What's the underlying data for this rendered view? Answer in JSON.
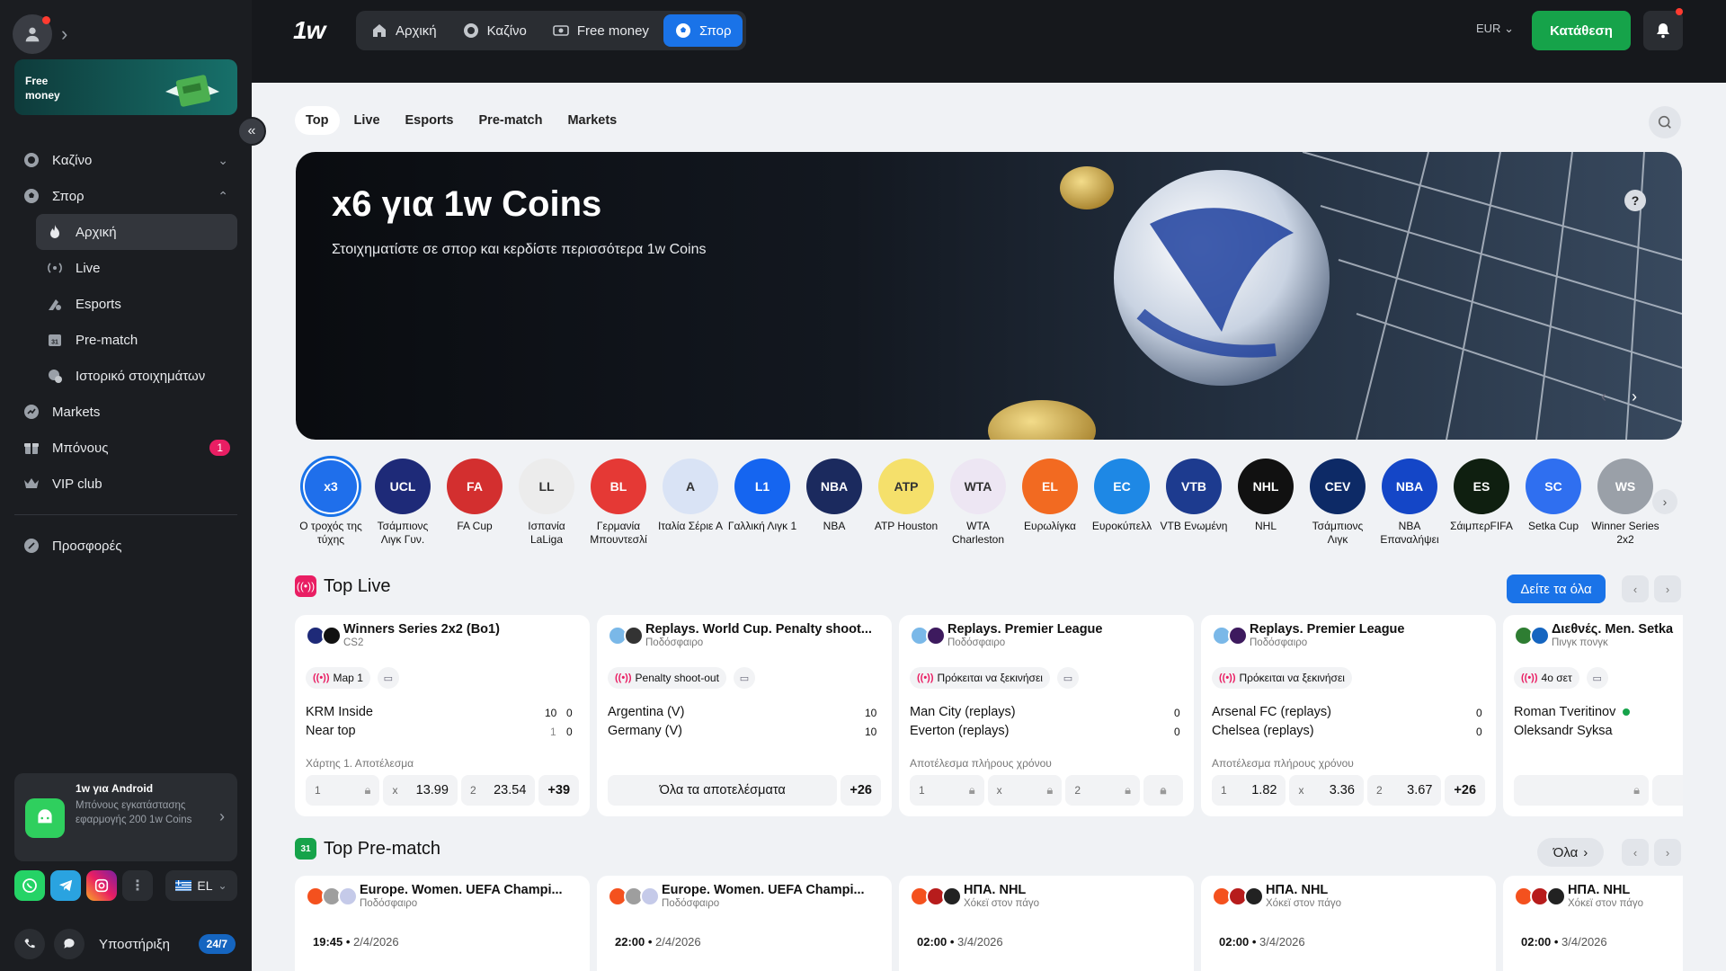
{
  "sidebar": {
    "promo_text": "Free money",
    "collapse_glyph": "«",
    "items": [
      {
        "label": "Καζίνο",
        "icon": "casino-chip-icon",
        "chev": "⌄"
      },
      {
        "label": "Σπορ",
        "icon": "soccer-ball-icon",
        "chev": "⌃"
      }
    ],
    "sub_items": [
      {
        "label": "Αρχική",
        "icon": "fire-icon",
        "active": true
      },
      {
        "label": "Live",
        "icon": "live-broadcast-icon"
      },
      {
        "label": "Esports",
        "icon": "esports-icon"
      },
      {
        "label": "Pre-match",
        "icon": "calendar-icon",
        "glyph": "31"
      },
      {
        "label": "Ιστορικό στοιχημάτων",
        "icon": "bet-history-icon"
      }
    ],
    "items2": [
      {
        "label": "Markets",
        "icon": "markets-icon"
      },
      {
        "label": "Μπόνους",
        "icon": "gift-icon",
        "badge": "1"
      },
      {
        "label": "VIP club",
        "icon": "crown-icon"
      }
    ],
    "offers": "Προσφορές",
    "app": {
      "title": "1w για Android",
      "desc": "Μπόνους εγκατάστασης εφαρμογής 200 1w Coins"
    },
    "lang": "EL",
    "support": "Υποστήριξη",
    "support_badge": "24/7"
  },
  "header": {
    "logo": "1w",
    "nav": [
      {
        "label": "Αρχική",
        "icon": "home-icon"
      },
      {
        "label": "Καζίνο",
        "icon": "casino-chip-icon"
      },
      {
        "label": "Free money",
        "icon": "money-icon"
      },
      {
        "label": "Σπορ",
        "icon": "soccer-ball-icon",
        "active": true
      }
    ],
    "currency": "EUR",
    "deposit": "Κατάθεση"
  },
  "subtabs": [
    "Top",
    "Live",
    "Esports",
    "Pre-match",
    "Markets"
  ],
  "banner": {
    "title": "x6 για 1w Coins",
    "subtitle": "Στοιχηματίστε σε σπορ και κερδίστε περισσότερα 1w Coins",
    "help": "?"
  },
  "leagues": [
    {
      "name": "Ο τροχός της τύχης",
      "color": "#1f6feb",
      "glyph": "x3"
    },
    {
      "name": "Τσάμπιονς Λιγκ Γυν.",
      "color": "#1e2a78",
      "glyph": "UCL"
    },
    {
      "name": "FA Cup",
      "color": "#d32f2f",
      "glyph": "FA"
    },
    {
      "name": "Ισπανία LaLiga",
      "color": "#ececec",
      "glyph": "LL"
    },
    {
      "name": "Γερμανία Μπουντεσλί",
      "color": "#e53935",
      "glyph": "BL"
    },
    {
      "name": "Ιταλία Σέριε Α",
      "color": "#d9e3f5",
      "glyph": "A"
    },
    {
      "name": "Γαλλική Λιγκ 1",
      "color": "#1565f0",
      "glyph": "L1"
    },
    {
      "name": "NBA",
      "color": "#1b2a5e",
      "glyph": "NBA"
    },
    {
      "name": "ATP Houston",
      "color": "#f5e06b",
      "glyph": "ATP"
    },
    {
      "name": "WTA Charleston",
      "color": "#ede6f3",
      "glyph": "WTA"
    },
    {
      "name": "Ευρωλίγκα",
      "color": "#f26a21",
      "glyph": "EL"
    },
    {
      "name": "Ευροκύπελλ",
      "color": "#1e88e5",
      "glyph": "EC"
    },
    {
      "name": "VTB Ενωμένη",
      "color": "#1d3b8f",
      "glyph": "VTB"
    },
    {
      "name": "NHL",
      "color": "#111",
      "glyph": "NHL"
    },
    {
      "name": "Τσάμπιονς Λιγκ",
      "color": "#0d2a66",
      "glyph": "CEV"
    },
    {
      "name": "NBA Επαναλήψει",
      "color": "#1446c7",
      "glyph": "NBA"
    },
    {
      "name": "ΣάιμπερFIFA",
      "color": "#0f1f10",
      "glyph": "ES"
    },
    {
      "name": "Setka Cup",
      "color": "#2f6ff0",
      "glyph": "SC"
    },
    {
      "name": "Winner Series 2x2",
      "color": "#9aa0a8",
      "glyph": "WS"
    }
  ],
  "top_live": {
    "title": "Top Live",
    "see_all": "Δείτε τα όλα",
    "cards": [
      {
        "title": "Winners Series 2x2 (Bo1)",
        "sport": "CS2",
        "status": "Map 1",
        "team1": "KRM Inside",
        "team2": "Near top",
        "s1a": "10",
        "s1b": "0",
        "s2a": "1",
        "s2b": "0",
        "market": "Χάρτης 1. Αποτέλεσμα",
        "o1l": "1",
        "o2l": "x",
        "o2": "13.99",
        "o3l": "2",
        "o3": "23.54",
        "more": "+39"
      },
      {
        "title": "Replays. World Cup. Penalty shoot...",
        "sport": "Ποδόσφαιρο",
        "status": "Penalty shoot-out",
        "team1": "Argentina (V)",
        "team2": "Germany (V)",
        "s1a": "10",
        "s2a": "10",
        "all_results": "Όλα τα αποτελέσματα",
        "more": "+26"
      },
      {
        "title": "Replays. Premier League",
        "sport": "Ποδόσφαιρο",
        "status": "Πρόκειται να ξεκινήσει",
        "team1": "Man City (replays)",
        "team2": "Everton (replays)",
        "s1a": "0",
        "s2a": "0",
        "market": "Αποτέλεσμα πλήρους χρόνου",
        "o1l": "1",
        "o2l": "x",
        "o3l": "2"
      },
      {
        "title": "Replays. Premier League",
        "sport": "Ποδόσφαιρο",
        "status": "Πρόκειται να ξεκινήσει",
        "team1": "Arsenal FC (replays)",
        "team2": "Chelsea (replays)",
        "s1a": "0",
        "s2a": "0",
        "market": "Αποτέλεσμα πλήρους χρόνου",
        "o1l": "1",
        "o1": "1.82",
        "o2l": "x",
        "o2": "3.36",
        "o3l": "2",
        "o3": "3.67",
        "more": "+26"
      },
      {
        "title": "Διεθνές. Men. Setka",
        "sport": "Πινγκ πονγκ",
        "status": "4ο σετ",
        "team1": "Roman Tveritinov",
        "team2": "Oleksandr Syksa"
      }
    ]
  },
  "top_prematch": {
    "title": "Top Pre-match",
    "all": "Όλα",
    "cards": [
      {
        "title": "Europe. Women. UEFA Champi...",
        "sport": "Ποδόσφαιρο",
        "time": "19:45",
        "date": "2/4/2026"
      },
      {
        "title": "Europe. Women. UEFA Champi...",
        "sport": "Ποδόσφαιρο",
        "time": "22:00",
        "date": "2/4/2026"
      },
      {
        "title": "ΗΠΑ. NHL",
        "sport": "Χόκεϊ στον πάγο",
        "time": "02:00",
        "date": "3/4/2026"
      },
      {
        "title": "ΗΠΑ. NHL",
        "sport": "Χόκεϊ στον πάγο",
        "time": "02:00",
        "date": "3/4/2026"
      },
      {
        "title": "ΗΠΑ. NHL",
        "sport": "Χόκεϊ στον πάγο",
        "time": "02:00",
        "date": "3/4/2026"
      }
    ]
  }
}
